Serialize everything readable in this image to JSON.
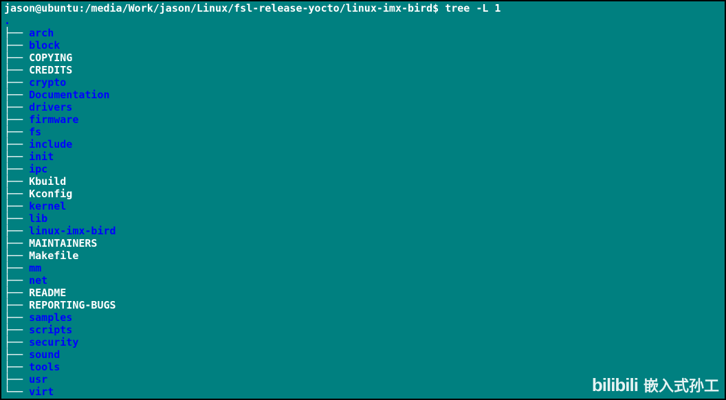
{
  "prompt": "jason@ubuntu:/media/Work/jason/Linux/fsl-release-yocto/linux-imx-bird$ ",
  "command": "tree -L 1",
  "root_dot": ".",
  "entries": [
    {
      "name": "arch",
      "type": "dir"
    },
    {
      "name": "block",
      "type": "dir"
    },
    {
      "name": "COPYING",
      "type": "file"
    },
    {
      "name": "CREDITS",
      "type": "file"
    },
    {
      "name": "crypto",
      "type": "dir"
    },
    {
      "name": "Documentation",
      "type": "dir"
    },
    {
      "name": "drivers",
      "type": "dir"
    },
    {
      "name": "firmware",
      "type": "dir"
    },
    {
      "name": "fs",
      "type": "dir"
    },
    {
      "name": "include",
      "type": "dir"
    },
    {
      "name": "init",
      "type": "dir"
    },
    {
      "name": "ipc",
      "type": "dir"
    },
    {
      "name": "Kbuild",
      "type": "file"
    },
    {
      "name": "Kconfig",
      "type": "file"
    },
    {
      "name": "kernel",
      "type": "dir"
    },
    {
      "name": "lib",
      "type": "dir"
    },
    {
      "name": "linux-imx-bird",
      "type": "dir"
    },
    {
      "name": "MAINTAINERS",
      "type": "file"
    },
    {
      "name": "Makefile",
      "type": "file"
    },
    {
      "name": "mm",
      "type": "dir"
    },
    {
      "name": "net",
      "type": "dir"
    },
    {
      "name": "README",
      "type": "file"
    },
    {
      "name": "REPORTING-BUGS",
      "type": "file"
    },
    {
      "name": "samples",
      "type": "dir"
    },
    {
      "name": "scripts",
      "type": "dir"
    },
    {
      "name": "security",
      "type": "dir"
    },
    {
      "name": "sound",
      "type": "dir"
    },
    {
      "name": "tools",
      "type": "dir"
    },
    {
      "name": "usr",
      "type": "dir"
    },
    {
      "name": "virt",
      "type": "dir"
    }
  ],
  "branch_mid": "├── ",
  "branch_last": "└── ",
  "watermark": {
    "bili": "bilibili",
    "text": "嵌入式孙工"
  }
}
